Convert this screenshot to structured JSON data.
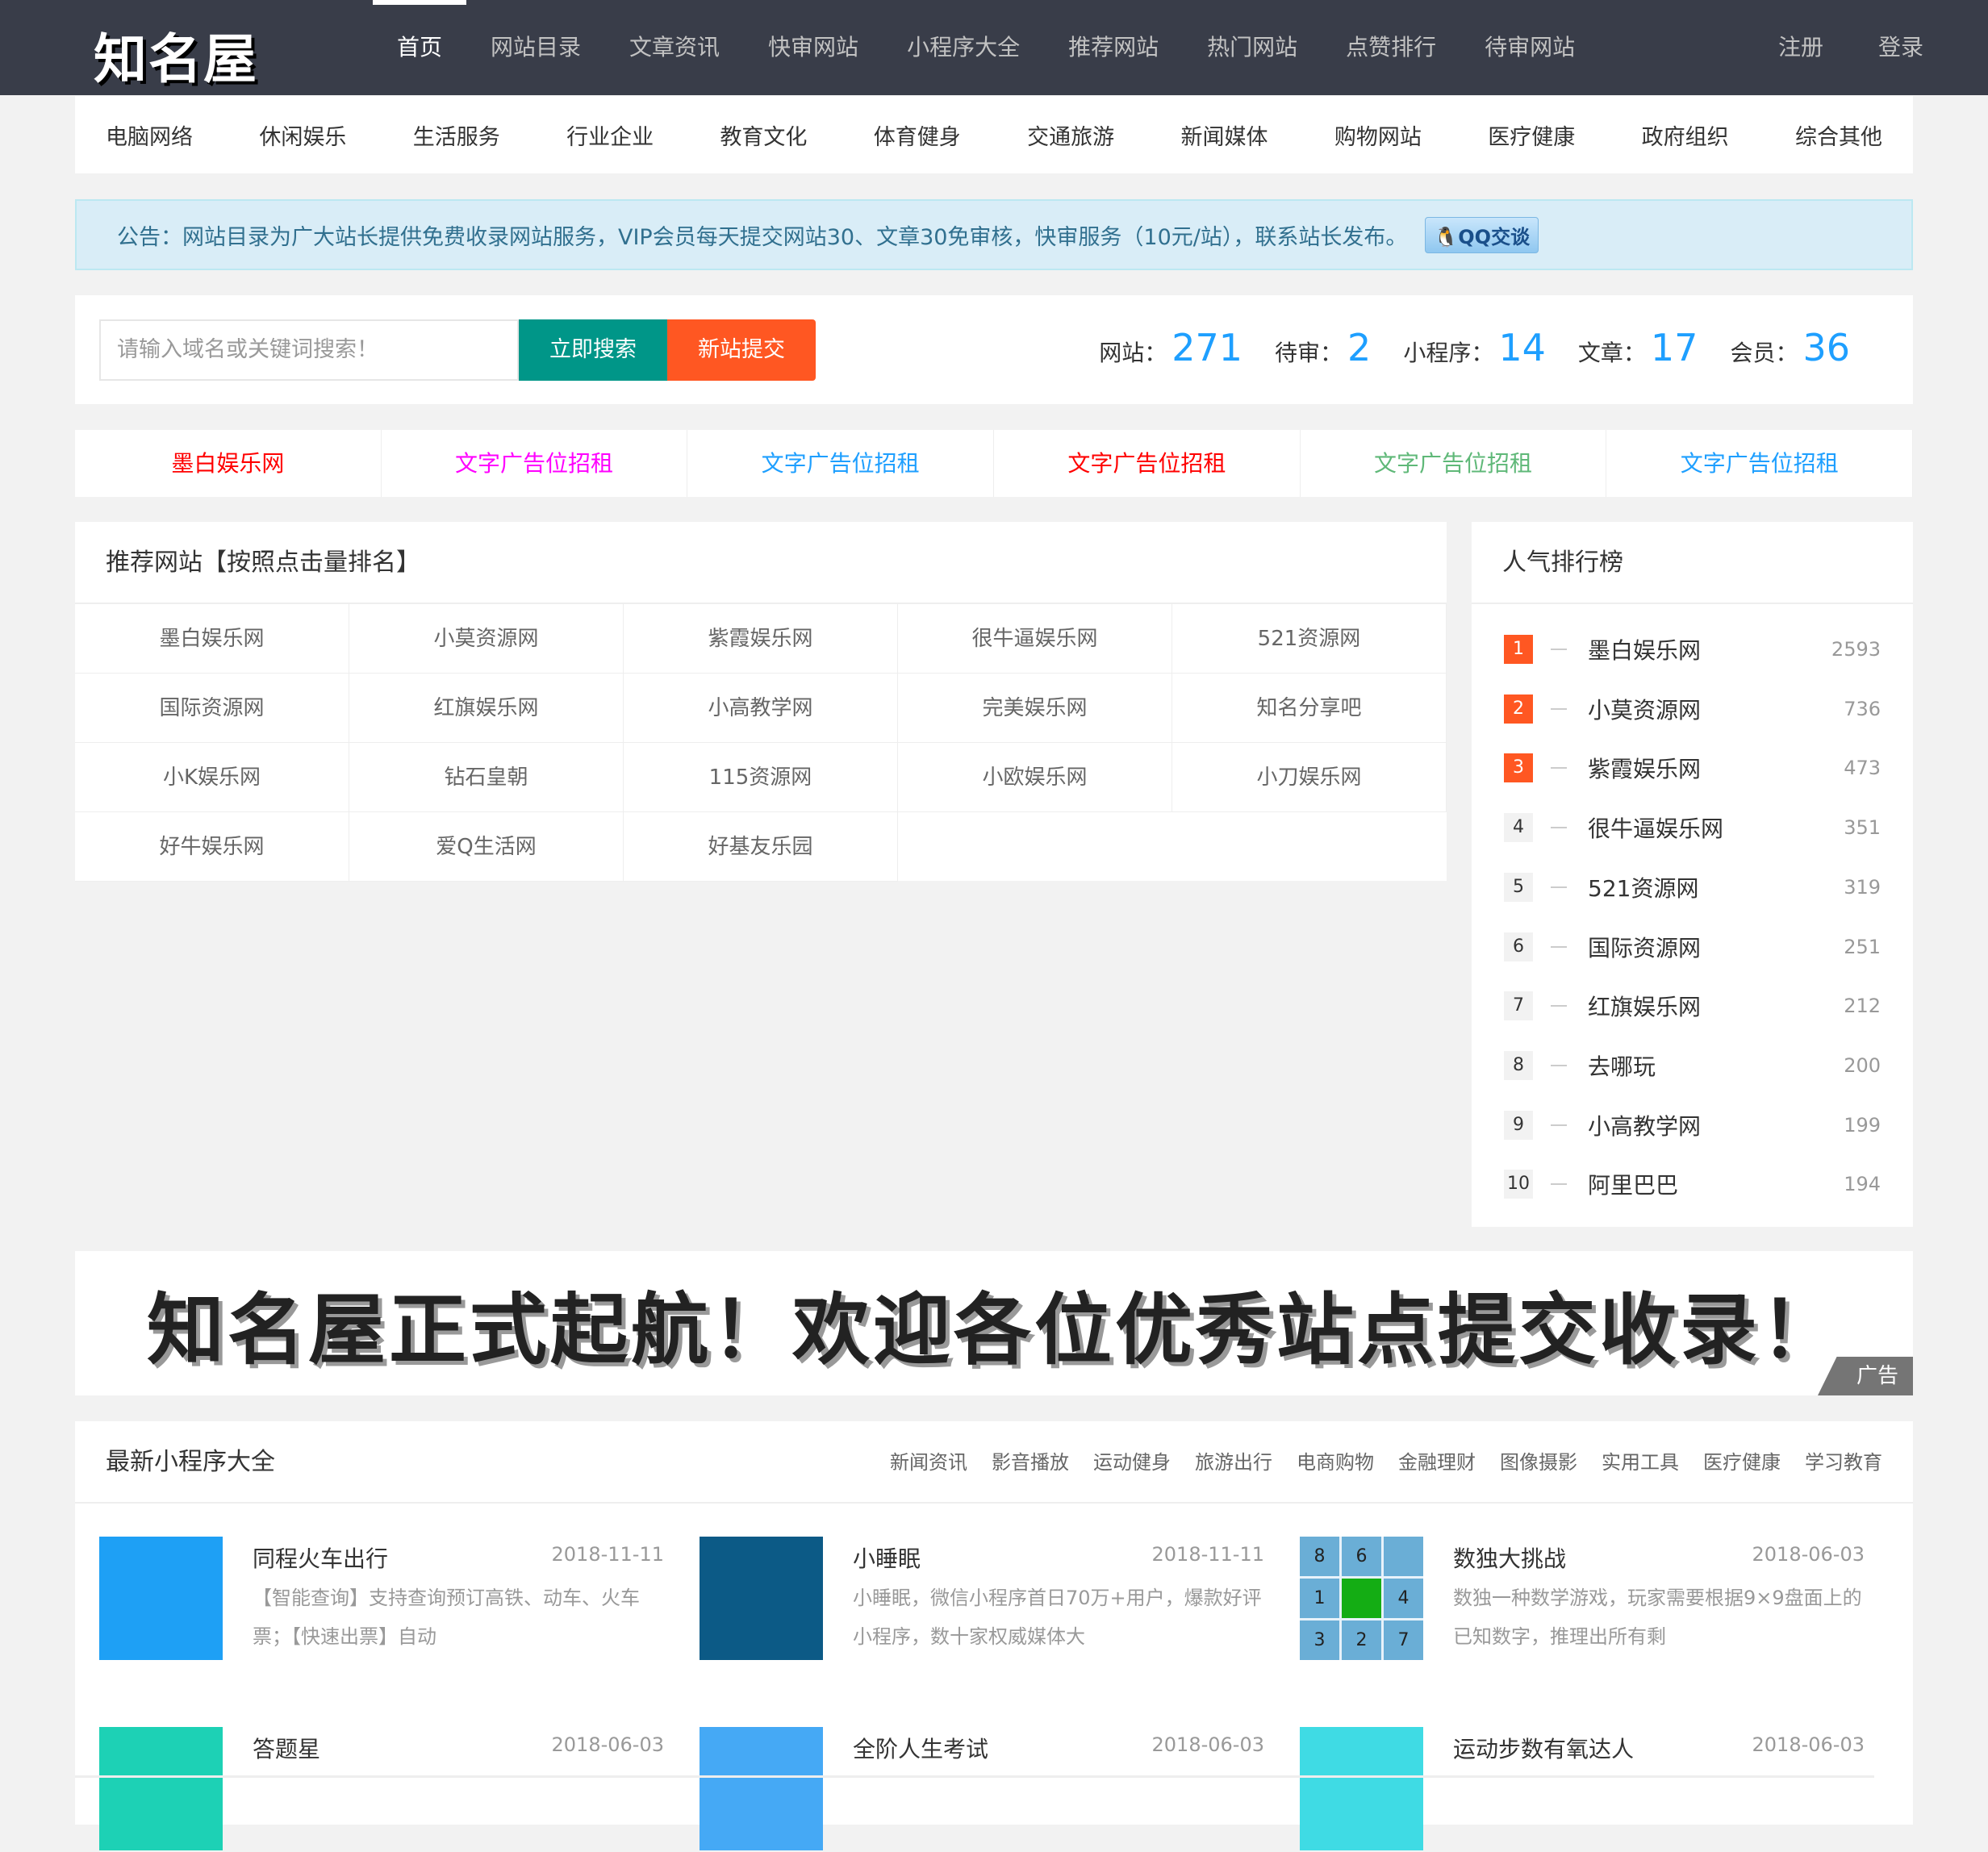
{
  "header": {
    "logo": "知名屋",
    "nav": [
      "首页",
      "网站目录",
      "文章资讯",
      "快审网站",
      "小程序大全",
      "推荐网站",
      "热门网站",
      "点赞排行",
      "待审网站"
    ],
    "active": "首页",
    "register": "注册",
    "login": "登录"
  },
  "categories": [
    "电脑网络",
    "休闲娱乐",
    "生活服务",
    "行业企业",
    "教育文化",
    "体育健身",
    "交通旅游",
    "新闻媒体",
    "购物网站",
    "医疗健康",
    "政府组织",
    "综合其他"
  ],
  "notice": {
    "text": "公告：网站目录为广大站长提供免费收录网站服务，VIP会员每天提交网站30、文章30免审核，快审服务（10元/站），联系站长发布。",
    "qq_button": "QQ交谈"
  },
  "search": {
    "placeholder": "请输入域名或关键词搜索！",
    "search_button": "立即搜索",
    "submit_button": "新站提交"
  },
  "stats": [
    {
      "label": "网站：",
      "value": "271"
    },
    {
      "label": "待审：",
      "value": "2"
    },
    {
      "label": "小程序：",
      "value": "14"
    },
    {
      "label": "文章：",
      "value": "17"
    },
    {
      "label": "会员：",
      "value": "36"
    }
  ],
  "ad_links": [
    {
      "text": "墨白娱乐网",
      "color": "#ff0000"
    },
    {
      "text": "文字广告位招租",
      "color": "#ff00ff"
    },
    {
      "text": "文字广告位招租",
      "color": "#1e9fff"
    },
    {
      "text": "文字广告位招租",
      "color": "#ff0000"
    },
    {
      "text": "文字广告位招租",
      "color": "#5fb878"
    },
    {
      "text": "文字广告位招租",
      "color": "#1e9fff"
    }
  ],
  "recommended": {
    "title": "推荐网站【按照点击量排名】",
    "sites": [
      "墨白娱乐网",
      "小莫资源网",
      "紫霞娱乐网",
      "很牛逼娱乐网",
      "521资源网",
      "国际资源网",
      "红旗娱乐网",
      "小高教学网",
      "完美娱乐网",
      "知名分享吧",
      "小K娱乐网",
      "钻石皇朝",
      "115资源网",
      "小欧娱乐网",
      "小刀娱乐网",
      "好牛娱乐网",
      "爱Q生活网",
      "好基友乐园"
    ]
  },
  "ranking": {
    "title": "人气排行榜",
    "items": [
      {
        "rank": "1",
        "name": "墨白娱乐网",
        "count": "2593"
      },
      {
        "rank": "2",
        "name": "小莫资源网",
        "count": "736"
      },
      {
        "rank": "3",
        "name": "紫霞娱乐网",
        "count": "473"
      },
      {
        "rank": "4",
        "name": "很牛逼娱乐网",
        "count": "351"
      },
      {
        "rank": "5",
        "name": "521资源网",
        "count": "319"
      },
      {
        "rank": "6",
        "name": "国际资源网",
        "count": "251"
      },
      {
        "rank": "7",
        "name": "红旗娱乐网",
        "count": "212"
      },
      {
        "rank": "8",
        "name": "去哪玩",
        "count": "200"
      },
      {
        "rank": "9",
        "name": "小高教学网",
        "count": "199"
      },
      {
        "rank": "10",
        "name": "阿里巴巴",
        "count": "194"
      }
    ]
  },
  "banner": {
    "text": "知名屋正式起航！欢迎各位优秀站点提交收录！",
    "tag": "广告"
  },
  "mini": {
    "title": "最新小程序大全",
    "tabs": [
      "新闻资讯",
      "影音播放",
      "运动健身",
      "旅游出行",
      "电商购物",
      "金融理财",
      "图像摄影",
      "实用工具",
      "医疗健康",
      "学习教育"
    ],
    "items": [
      {
        "name": "同程火车出行",
        "date": "2018-11-11",
        "desc": "【智能查询】支持查询预订高铁、动车、火车票；【快速出票】自动",
        "icon_color": "#1ea0f5"
      },
      {
        "name": "小睡眠",
        "date": "2018-11-11",
        "desc": "小睡眠，微信小程序首日70万+用户，爆款好评小程序，数十家权威媒体大",
        "icon_color": "#0c5a86"
      },
      {
        "name": "数独大挑战",
        "date": "2018-06-03",
        "desc": "数独一种数学游戏，玩家需要根据9×9盘面上的已知数字，推理出所有剩",
        "icon_color": "#6aaed6",
        "sudoku": [
          "8",
          "6",
          "",
          "1",
          "",
          "4",
          "3",
          "2",
          "7"
        ]
      },
      {
        "name": "答题星",
        "date": "2018-06-03",
        "desc": "",
        "icon_color": "#1dd1b5"
      },
      {
        "name": "全阶人生考试",
        "date": "2018-06-03",
        "desc": "",
        "icon_color": "#45a9f5"
      },
      {
        "name": "运动步数有氧达人",
        "date": "2018-06-03",
        "desc": "",
        "icon_color": "#3fdbe4"
      }
    ]
  }
}
